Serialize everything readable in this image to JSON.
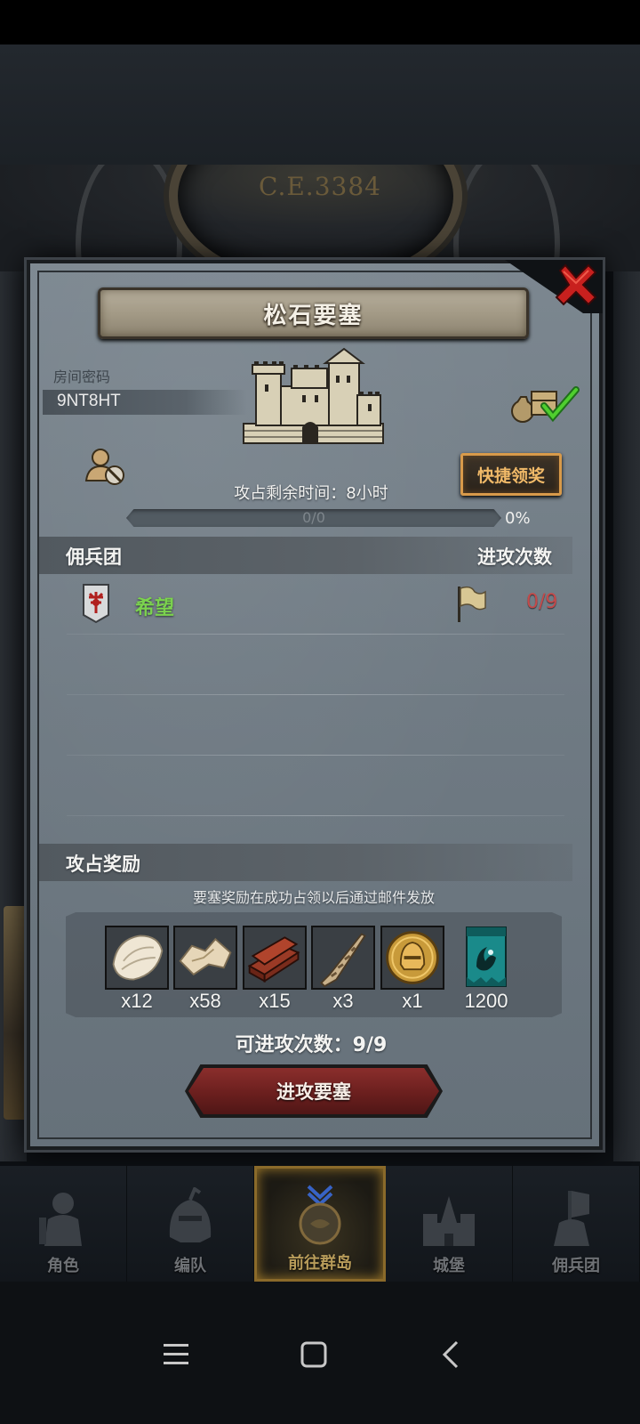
{
  "background": {
    "era_label": "C.E.3384"
  },
  "dialog": {
    "title": "松石要塞",
    "room_password_label": "房间密码",
    "room_password": "9NT8HT",
    "quick_claim_label": "快捷领奖",
    "remaining_time": "攻占剩余时间：8小时",
    "progress_text": "0/0",
    "progress_percent": "0%",
    "progress_fraction": 0,
    "mercenary_header": "佣兵团",
    "attacks_header": "进攻次数",
    "mercenaries": [
      {
        "name": "希望",
        "attacks": "0/9",
        "name_color": "#7bd24e",
        "count_color": "#c44a4a",
        "emblem": "red-crest-shield-icon",
        "flag": "flag-icon"
      }
    ],
    "rewards_header": "攻占奖励",
    "rewards_note": "要塞奖励在成功占领以后通过邮件发放",
    "rewards": [
      {
        "icon": "white-fur-icon",
        "qty": "x12"
      },
      {
        "icon": "pelt-icon",
        "qty": "x58"
      },
      {
        "icon": "wood-planks-icon",
        "qty": "x15"
      },
      {
        "icon": "horn-icon",
        "qty": "x3"
      },
      {
        "icon": "gold-helmet-coin-icon",
        "qty": "x1"
      },
      {
        "icon": "teal-banner-icon",
        "qty": "1200"
      }
    ],
    "attack_count": "可进攻次数：9/9",
    "attack_button": "进攻要塞"
  },
  "bottom_nav": {
    "items": [
      {
        "label": "角色",
        "icon": "knight-icon",
        "active": false
      },
      {
        "label": "编队",
        "icon": "helmet-icon",
        "active": false
      },
      {
        "label": "前往群岛",
        "icon": "compass-icon",
        "active": true
      },
      {
        "label": "城堡",
        "icon": "castle-icon",
        "active": false
      },
      {
        "label": "佣兵团",
        "icon": "mercenary-icon",
        "active": false
      }
    ]
  },
  "system_nav": [
    "menu-icon",
    "home-icon",
    "back-icon"
  ],
  "colors": {
    "accent_gold": "#d89a4a",
    "merc_green": "#7bd24e",
    "count_red": "#c44a4a",
    "attack_button": "#6b1f1e"
  }
}
